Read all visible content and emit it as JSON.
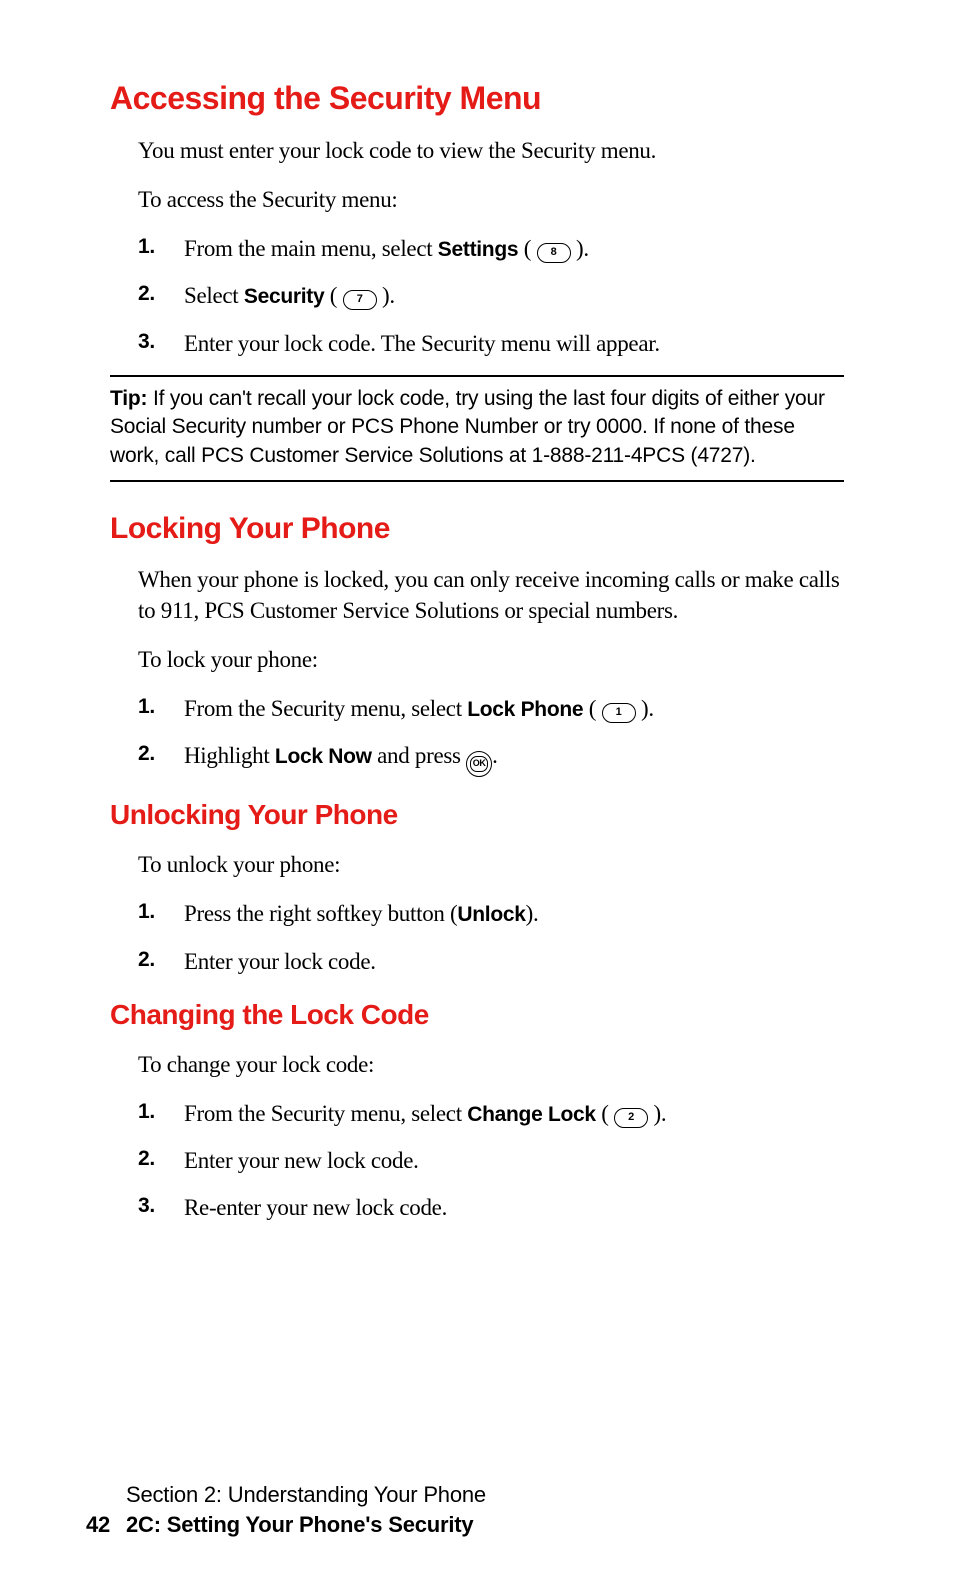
{
  "sections": {
    "accessing": {
      "heading": "Accessing the Security Menu",
      "intro": "You must enter your lock code to view the Security menu.",
      "lead": "To access the Security menu:",
      "step1_pre": "From the main menu, select ",
      "step1_bold": "Settings",
      "step1_open": " ( ",
      "step1_key": "8",
      "step1_close": " ).",
      "step2_pre": "Select ",
      "step2_bold": "Security",
      "step2_open": " ( ",
      "step2_key": "7",
      "step2_close": " ).",
      "step3": "Enter your lock code. The Security menu will appear."
    },
    "tip": {
      "label": "Tip: ",
      "text": "If you can't recall your lock code, try using the last four digits of either your Social Security number or PCS Phone Number or try 0000. If none of these work, call PCS Customer Service Solutions at 1-888-211-4PCS (4727)."
    },
    "locking": {
      "heading": "Locking Your Phone",
      "intro": "When your phone is locked, you can only receive incoming calls or make calls to 911, PCS Customer Service Solutions or special numbers.",
      "lead": "To lock your phone:",
      "step1_pre": "From the Security menu, select ",
      "step1_bold": "Lock Phone",
      "step1_open": " ( ",
      "step1_key": "1",
      "step1_close": " ).",
      "step2_pre": "Highlight ",
      "step2_bold": "Lock Now",
      "step2_mid": " and press ",
      "step2_ok": "OK",
      "step2_end": "."
    },
    "unlocking": {
      "heading": "Unlocking Your Phone",
      "lead": "To unlock your phone:",
      "step1_pre": "Press the right softkey button (",
      "step1_bold": "Unlock",
      "step1_close": ").",
      "step2": "Enter your lock code."
    },
    "changing": {
      "heading": "Changing the Lock Code",
      "lead": "To change your lock code:",
      "step1_pre": "From the Security menu, select ",
      "step1_bold": "Change Lock",
      "step1_open": " ( ",
      "step1_key": "2",
      "step1_close": " ).",
      "step2": "Enter your new lock code.",
      "step3": "Re-enter your new lock code."
    }
  },
  "footer": {
    "section_label": "Section 2: Understanding Your Phone",
    "page_number": "42",
    "chapter": "2C: Setting Your Phone's Security"
  }
}
